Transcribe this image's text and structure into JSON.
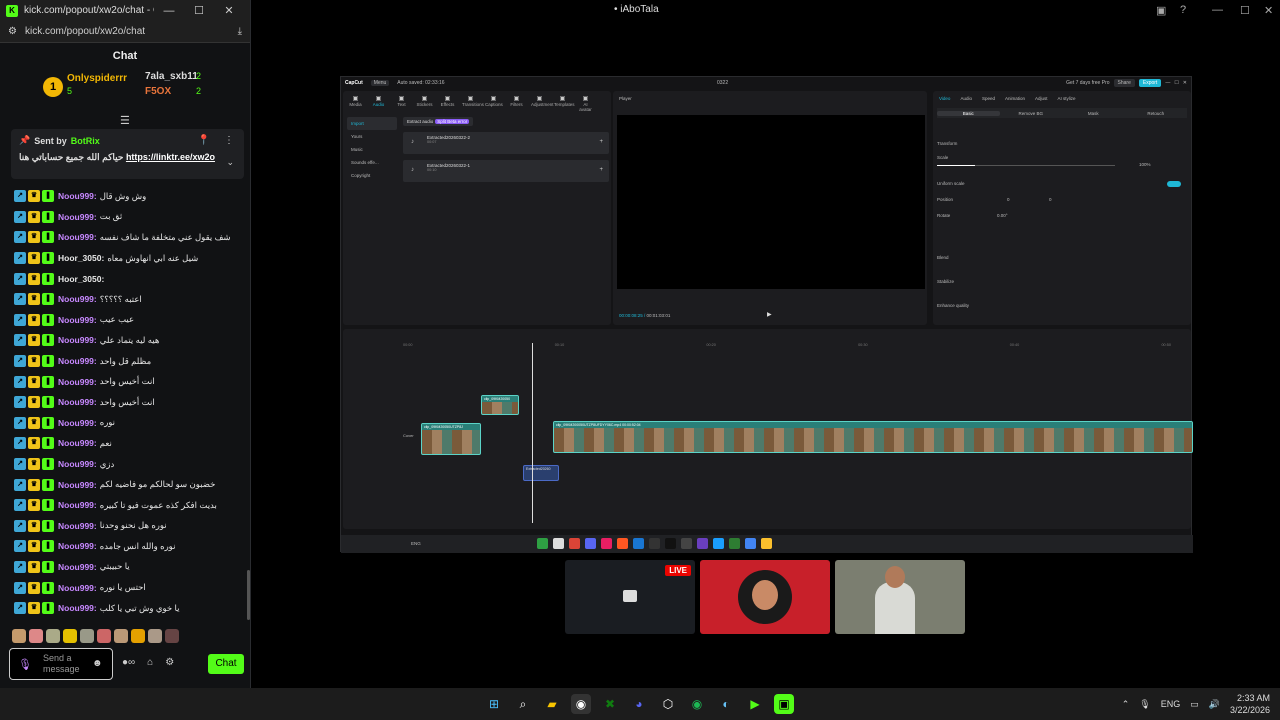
{
  "browser": {
    "title": "kick.com/popout/xw2o/chat - Googl...",
    "url": "kick.com/popout/xw2o/chat"
  },
  "chat": {
    "header": "Chat",
    "leaderboard": {
      "first": {
        "name": "Onlyspiderrr",
        "rank": "1",
        "count": "5"
      },
      "second": {
        "name": "7ala_sxb11",
        "count": "2"
      },
      "third": {
        "name": "F5OX",
        "count": "2"
      }
    },
    "pinned": {
      "sent_by": "Sent by",
      "bot": "BotRix",
      "message": "حياكم الله جميع حساباتي هنا",
      "link": "https://linktr.ee/xw2o"
    },
    "messages": [
      {
        "user": "Noou999:",
        "text": "وش وش قال",
        "color": "purple"
      },
      {
        "user": "Noou999:",
        "text": "ثق بت",
        "color": "purple"
      },
      {
        "user": "Noou999:",
        "text": "شف يقول عني متخلفة ما شاف نفسه",
        "color": "purple"
      },
      {
        "user": "Hoor_3050:",
        "text": "شيل عنه ابي انهاوش معاه",
        "color": "white"
      },
      {
        "user": "Hoor_3050:",
        "text": "",
        "color": "white"
      },
      {
        "user": "Noou999:",
        "text": "اعتبه ؟؟؟؟؟",
        "color": "purple"
      },
      {
        "user": "Noou999:",
        "text": "عيب عيب",
        "color": "purple"
      },
      {
        "user": "Noou999:",
        "text": "هيه ليه يتماد علي",
        "color": "purple"
      },
      {
        "user": "Noou999:",
        "text": "مظلم قل واحد",
        "color": "purple"
      },
      {
        "user": "Noou999:",
        "text": "انت أخيس واحد",
        "color": "purple"
      },
      {
        "user": "Noou999:",
        "text": "انت أخيس واحد",
        "color": "purple"
      },
      {
        "user": "Noou999:",
        "text": "نوره",
        "color": "purple"
      },
      {
        "user": "Noou999:",
        "text": "نعم",
        "color": "purple"
      },
      {
        "user": "Noou999:",
        "text": "دزي",
        "color": "purple"
      },
      {
        "user": "Noou999:",
        "text": "خضبون سو لحالكم مو فاضيه لكم",
        "color": "purple"
      },
      {
        "user": "Noou999:",
        "text": "بديت افكر كذه عموت فيو تا كبيره",
        "color": "purple"
      },
      {
        "user": "Noou999:",
        "text": "نوره هل نحنو وحدنا",
        "color": "purple"
      },
      {
        "user": "Noou999:",
        "text": "نوره والله انس جامده",
        "color": "purple"
      },
      {
        "user": "Noou999:",
        "text": "يا حبيبتي",
        "color": "purple"
      },
      {
        "user": "Noou999:",
        "text": "احتس يا نوره",
        "color": "purple"
      },
      {
        "user": "Noou999:",
        "text": "يا خوي وش تبي يا كلب",
        "color": "purple"
      }
    ],
    "input_placeholder": "Send a message",
    "chat_button": "Chat"
  },
  "stream": {
    "channel": "• iAboTala",
    "live_label": "LIVE"
  },
  "capcut": {
    "app": "CapCut",
    "menu": "Menu",
    "autosave": "Auto saved: 02:33:16",
    "project": "0322",
    "promo": "Get 7 days free Pro",
    "share": "Share",
    "export": "Export",
    "tools": [
      "Media",
      "Audio",
      "Text",
      "Stickers",
      "Effects",
      "Transitions",
      "Captions",
      "Filters",
      "Adjustment",
      "Templates",
      "AI avatar"
    ],
    "categories": [
      "Import",
      "Yours",
      "Music",
      "Sounds effe...",
      "Copyright"
    ],
    "extract": "Extract audio",
    "extract_tag": "Split Beta error",
    "audio_items": [
      {
        "name": "Extracted20260322-2",
        "dur": "00:07"
      },
      {
        "name": "Extracted20260322-1",
        "dur": "00:10"
      }
    ],
    "player_label": "Player",
    "timecode": "00:00:08:25",
    "duration": "00:01:03:01",
    "prop_tabs": [
      "Video",
      "Audio",
      "Speed",
      "Animation",
      "Adjust",
      "AI stylize"
    ],
    "prop_subtabs": [
      "Basic",
      "Remove BG",
      "Mask",
      "Retouch"
    ],
    "transform": "Transform",
    "scale": "Scale",
    "scale_val": "100%",
    "uniform": "Uniform scale",
    "position": "Position",
    "pos_x": "0",
    "pos_y": "0",
    "rotate": "Rotate",
    "rotate_val": "0.00°",
    "blend": "Blend",
    "stabilize": "Stabilize",
    "enhance": "Enhance quality",
    "ruler": [
      "00:00",
      "00:10",
      "00:20",
      "00:30",
      "00:40",
      "00:50"
    ],
    "clip1": "clip_09KM20050UTZP8J",
    "clip2": "clip_09KM20050",
    "clip3": "clip_09KM200050UTZP8UFDYY06C.mp4  00:00:52:04",
    "audio_clip": "Extracted20260",
    "cover": "Cover",
    "lang": "ENG"
  },
  "taskbar": {
    "lang": "ENG",
    "time": "2:33 AM",
    "date": "3/22/2026"
  }
}
